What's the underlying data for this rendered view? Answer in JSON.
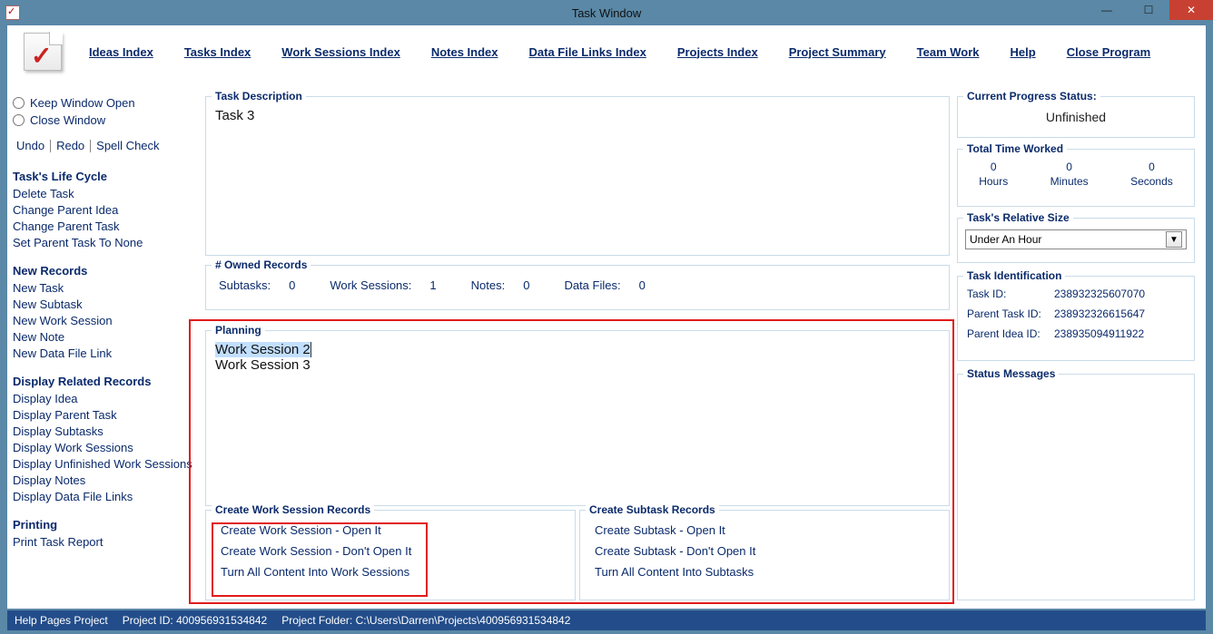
{
  "window": {
    "title": "Task Window"
  },
  "menu": {
    "ideas_index": "Ideas Index",
    "tasks_index": "Tasks Index",
    "work_sessions_index": "Work Sessions Index",
    "notes_index": "Notes Index",
    "data_file_links_index": "Data File Links Index",
    "projects_index": "Projects Index",
    "project_summary": "Project Summary",
    "team_work": "Team Work",
    "help": "Help",
    "close_program": "Close Program"
  },
  "sidebar": {
    "keep_open": "Keep Window Open",
    "close_window": "Close Window",
    "undo": "Undo",
    "redo": "Redo",
    "spell": "Spell Check",
    "life_cycle_head": "Task's Life Cycle",
    "delete_task": "Delete Task",
    "change_parent_idea": "Change Parent Idea",
    "change_parent_task": "Change Parent Task",
    "set_parent_none": "Set Parent Task To None",
    "new_records_head": "New Records",
    "new_task": "New Task",
    "new_subtask": "New Subtask",
    "new_work_session": "New Work Session",
    "new_note": "New Note",
    "new_data_file_link": "New Data File Link",
    "display_head": "Display Related Records",
    "display_idea": "Display Idea",
    "display_parent_task": "Display Parent Task",
    "display_subtasks": "Display Subtasks",
    "display_work_sessions": "Display Work Sessions",
    "display_unfinished_ws": "Display Unfinished Work Sessions",
    "display_notes": "Display Notes",
    "display_data_file_links": "Display Data File Links",
    "printing_head": "Printing",
    "print_task_report": "Print Task Report"
  },
  "task_description": {
    "legend": "Task Description",
    "value": "Task 3"
  },
  "owned_records": {
    "legend": "# Owned Records",
    "subtasks_label": "Subtasks:",
    "subtasks": "0",
    "ws_label": "Work Sessions:",
    "ws": "1",
    "notes_label": "Notes:",
    "notes": "0",
    "data_files_label": "Data Files:",
    "data_files": "0"
  },
  "planning": {
    "legend": "Planning",
    "items": [
      "Work Session 2",
      "Work Session 3"
    ]
  },
  "create_ws": {
    "legend": "Create Work Session Records",
    "open": "Create Work Session - Open It",
    "dont_open": "Create Work Session - Don't Open It",
    "turn_all": "Turn All Content Into Work Sessions"
  },
  "create_st": {
    "legend": "Create Subtask Records",
    "open": "Create Subtask - Open It",
    "dont_open": "Create Subtask - Don't Open It",
    "turn_all": "Turn All Content Into Subtasks"
  },
  "progress": {
    "legend": "Current Progress Status:",
    "value": "Unfinished"
  },
  "time": {
    "legend": "Total Time Worked",
    "hours": "0",
    "hours_label": "Hours",
    "minutes": "0",
    "minutes_label": "Minutes",
    "seconds": "0",
    "seconds_label": "Seconds"
  },
  "size": {
    "legend": "Task's Relative Size",
    "value": "Under An Hour"
  },
  "ident": {
    "legend": "Task Identification",
    "task_id_label": "Task ID:",
    "task_id": "238932325607070",
    "parent_task_id_label": "Parent Task ID:",
    "parent_task_id": "238932326615647",
    "parent_idea_id_label": "Parent Idea ID:",
    "parent_idea_id": "238935094911922"
  },
  "status_messages": {
    "legend": "Status Messages"
  },
  "statusbar": {
    "help": "Help Pages Project",
    "project_id_label": "Project ID:",
    "project_id": "400956931534842",
    "folder_label": "Project Folder:",
    "folder": "C:\\Users\\Darren\\Projects\\400956931534842"
  }
}
